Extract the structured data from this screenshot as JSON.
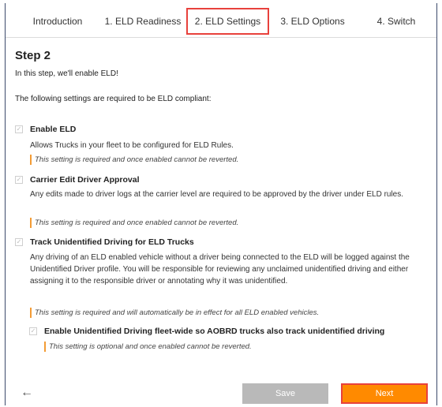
{
  "tabs": [
    {
      "label": "Introduction"
    },
    {
      "label": "1. ELD Readiness"
    },
    {
      "label": "2. ELD Settings"
    },
    {
      "label": "3. ELD Options"
    },
    {
      "label": "4. Switch"
    }
  ],
  "active_tab": 2,
  "step": {
    "title": "Step 2",
    "intro": "In this step, we'll enable ELD!",
    "requirement_text": "The following settings are required to be ELD compliant:"
  },
  "settings": [
    {
      "title": "Enable ELD",
      "description": "Allows Trucks in your fleet to be configured for ELD Rules.",
      "note": "This setting is required and once enabled cannot be reverted.",
      "checked": true
    },
    {
      "title": "Carrier Edit Driver Approval",
      "description": "Any edits made to driver logs at the carrier level are required to be approved by the driver under ELD rules.",
      "note": "This setting is required and once enabled cannot be reverted.",
      "checked": true
    },
    {
      "title": "Track Unidentified Driving for ELD Trucks",
      "description": "Any driving of an ELD enabled vehicle without a driver being connected to the ELD will be logged against the Unidentified Driver profile. You will be responsible for reviewing any unclaimed unidentified driving and either assigning it to the responsible driver or annotating why it was unidentified.",
      "note": "This setting is required and will automatically be in effect for all ELD enabled vehicles.",
      "checked": true
    },
    {
      "title": "Enable Unidentified Driving fleet-wide so AOBRD trucks also track unidentified driving",
      "description": "",
      "note": "This setting is optional and once enabled cannot be reverted.",
      "checked": true
    }
  ],
  "buttons": {
    "back": "←",
    "save": "Save",
    "next": "Next"
  },
  "colors": {
    "accent": "#ff8a00",
    "highlight_border": "#e8413c",
    "note_bar": "#f39c35",
    "disabled_button": "#b9b9b9"
  }
}
